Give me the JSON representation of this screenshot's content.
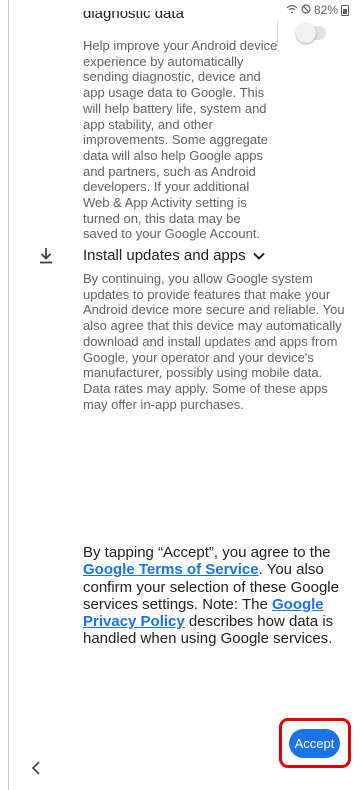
{
  "status_bar": {
    "wifi_icon": "wifi-icon",
    "dnd_icon": "do-not-disturb-icon",
    "battery": "82%"
  },
  "diagnostic": {
    "title": "diagnostic data",
    "toggle_state": "off",
    "description": "Help improve your Android device experience by automatically sending diagnostic, device and app usage data to Google. This will help battery life, system and app stability, and other improvements. Some aggregate data will also help Google apps and partners, such as Android developers. If your additional Web & App Activity setting is turned on, this data may be saved to your Google Account."
  },
  "install_updates": {
    "title": "Install updates and apps",
    "description": "By continuing, you allow Google system updates to provide features that make your Android device more secure and reliable. You also agree that this device may automatically download and install updates and apps from Google, your operator and your device's manufacturer, possibly using mobile data. Data rates may apply. Some of these apps may offer in-app purchases."
  },
  "consent": {
    "part1": "By tapping “Accept”, you agree to the ",
    "tos_link": "Google Terms of Service",
    "part2": ". You also confirm your selection of these Google services settings. Note: The ",
    "privacy_link": "Google Privacy Policy",
    "part3": " describes how data is handled when using Google services."
  },
  "accept_label": "Accept",
  "colors": {
    "accent": "#1a73e8",
    "highlight": "#e00000"
  }
}
